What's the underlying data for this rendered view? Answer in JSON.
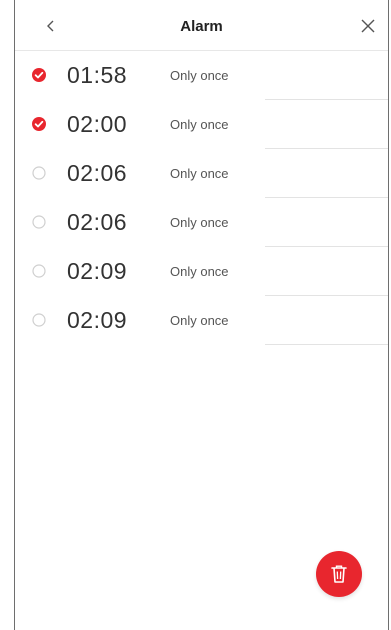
{
  "header": {
    "title": "Alarm",
    "back_icon": "chevron-left-icon",
    "close_icon": "close-icon"
  },
  "alarms": [
    {
      "time": "01:58",
      "repeat": "Only once",
      "selected": true
    },
    {
      "time": "02:00",
      "repeat": "Only once",
      "selected": true
    },
    {
      "time": "02:06",
      "repeat": "Only once",
      "selected": false
    },
    {
      "time": "02:06",
      "repeat": "Only once",
      "selected": false
    },
    {
      "time": "02:09",
      "repeat": "Only once",
      "selected": false
    },
    {
      "time": "02:09",
      "repeat": "Only once",
      "selected": false
    }
  ],
  "delete_button": {
    "icon": "trash-icon"
  },
  "colors": {
    "accent": "#e8262e",
    "unchecked_border": "#cfcfcf"
  }
}
